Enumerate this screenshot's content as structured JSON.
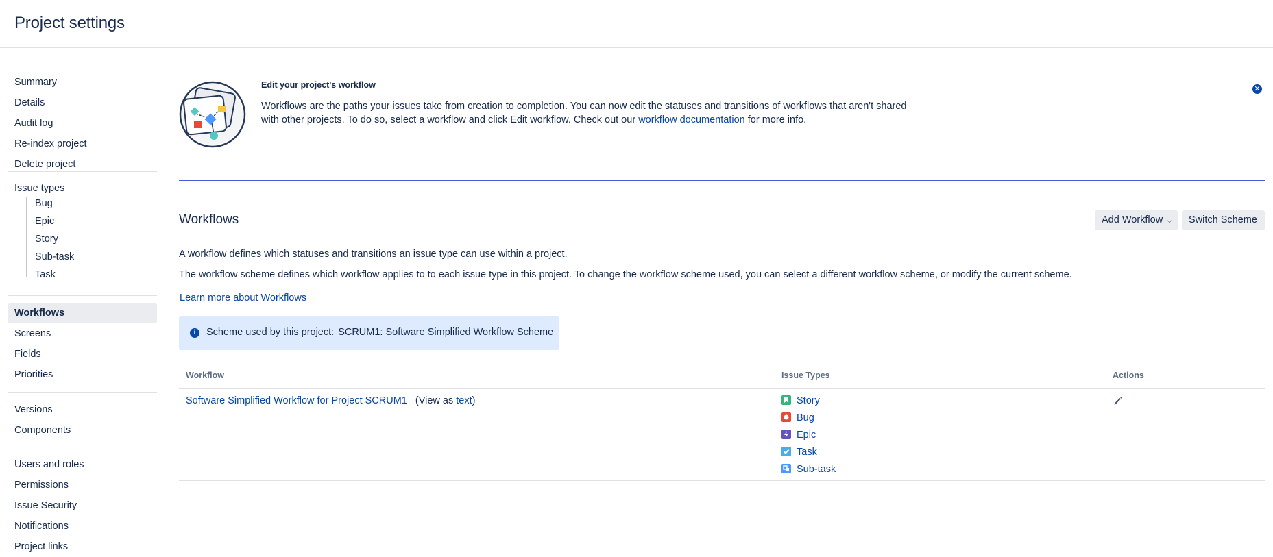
{
  "header": {
    "title": "Project settings"
  },
  "sidebar": {
    "items": [
      "Summary",
      "Details",
      "Audit log",
      "Re-index project",
      "Delete project"
    ],
    "issue_types_label": "Issue types",
    "issue_types": [
      "Bug",
      "Epic",
      "Story",
      "Sub-task",
      "Task"
    ],
    "group2": [
      "Workflows",
      "Screens",
      "Fields",
      "Priorities"
    ],
    "group3": [
      "Versions",
      "Components"
    ],
    "group4": [
      "Users and roles",
      "Permissions",
      "Issue Security",
      "Notifications",
      "Project links"
    ],
    "active": "Workflows"
  },
  "banner": {
    "title": "Edit your project's workflow",
    "text_1": "Workflows are the paths your issues take from creation to completion. You can now edit the statuses and transitions of workflows that aren't shared with other projects. To do so, select a workflow and click Edit workflow. Check out our",
    "link": "workflow documentation",
    "text_2": "for more info.",
    "close_icon": "close-circle-icon"
  },
  "workflows": {
    "title": "Workflows",
    "add_button": "Add Workflow",
    "switch_button": "Switch Scheme",
    "desc_1": "A workflow defines which statuses and transitions an issue type can use within a project.",
    "desc_2": "The workflow scheme defines which workflow applies to to each issue type in this project. To change the workflow scheme used, you can select a different workflow scheme, or modify the current scheme.",
    "learn_more": "Learn more about Workflows",
    "scheme_label": "Scheme used by this project:",
    "scheme_value": "SCRUM1: Software Simplified Workflow Scheme"
  },
  "table": {
    "headers": {
      "workflow": "Workflow",
      "issue_types": "Issue Types",
      "actions": "Actions"
    },
    "rows": [
      {
        "workflow": "Software Simplified Workflow for Project SCRUM1",
        "view_prefix": "(View as",
        "view_link": "text",
        "view_suffix": ")",
        "issue_types": [
          {
            "name": "Story",
            "color": "#36b37e",
            "icon": "story-icon"
          },
          {
            "name": "Bug",
            "color": "#e5493a",
            "icon": "bug-icon"
          },
          {
            "name": "Epic",
            "color": "#6554c0",
            "icon": "epic-icon"
          },
          {
            "name": "Task",
            "color": "#4bade8",
            "icon": "task-icon"
          },
          {
            "name": "Sub-task",
            "color": "#4c9aff",
            "icon": "subtask-icon"
          }
        ],
        "action_icon": "pencil-icon"
      }
    ]
  },
  "colors": {
    "link": "#0747a6",
    "info_bg": "#deebff",
    "text": "#172b4d"
  }
}
